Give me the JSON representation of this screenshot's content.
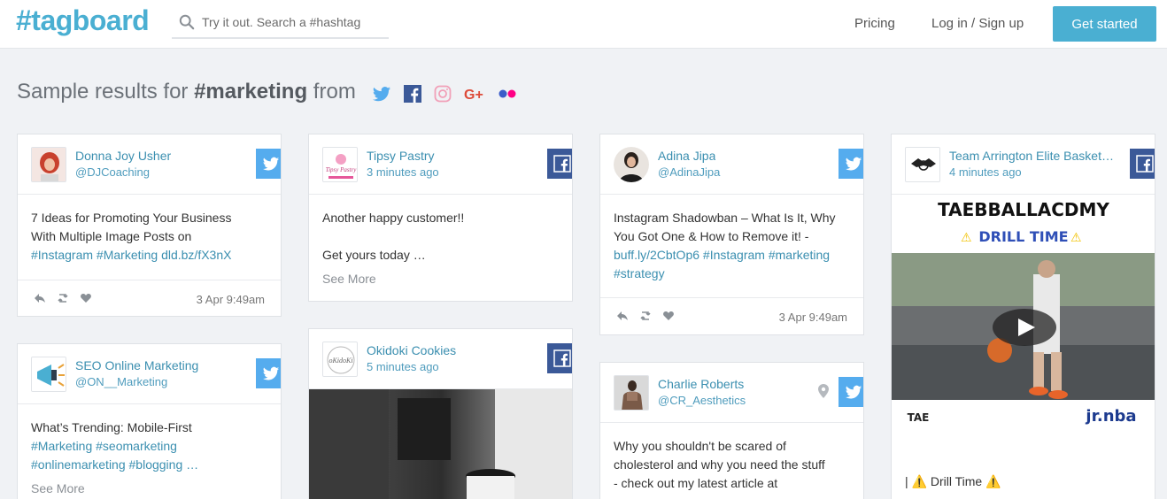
{
  "header": {
    "logo": "#tagboard",
    "search_placeholder": "Try it out. Search a #hashtag",
    "pricing": "Pricing",
    "login": "Log in / Sign up",
    "get_started": "Get started"
  },
  "results": {
    "prefix": "Sample results for ",
    "hashtag": "#marketing",
    "suffix": " from",
    "networks": [
      "twitter-icon",
      "facebook-icon",
      "instagram-icon",
      "google-plus-icon",
      "flickr-icon"
    ]
  },
  "colors": {
    "accent": "#4aafd2",
    "twitter": "#55acee",
    "facebook": "#3b5998",
    "link": "#3b8fb0"
  },
  "cards": {
    "donna": {
      "author": "Donna Joy Usher",
      "handle": "@DJCoaching",
      "network": "twitter",
      "line1": "7 Ideas for Promoting Your Business",
      "line2": "With Multiple Image Posts on",
      "line3": "#Instagram #Marketing dld.bz/fX3nX",
      "timestamp": "3 Apr 9:49am"
    },
    "seo": {
      "author": "SEO Online Marketing",
      "handle": "@ON__Marketing",
      "network": "twitter",
      "line1": "What’s Trending: Mobile-First",
      "line2": "#Marketing #seomarketing",
      "line3": "#onlinemarketing #blogging …",
      "see_more": "See More"
    },
    "tipsy": {
      "author": "Tipsy Pastry",
      "handle": "3 minutes ago",
      "network": "facebook",
      "avatar_text": "Tipsy Pastry",
      "line1": "Another happy customer!!",
      "line2": "Get yours today …",
      "see_more": "See More"
    },
    "okidoki": {
      "author": "Okidoki Cookies",
      "handle": "5 minutes ago",
      "network": "facebook",
      "avatar_text": "oKidoKi"
    },
    "adina": {
      "author": "Adina Jipa",
      "handle": "@AdinaJipa",
      "network": "twitter",
      "line1": "Instagram Shadowban – What Is It, Why",
      "line2": "You Got One & How to Remove it! -",
      "line3": "buff.ly/2CbtOp6 #Instagram #marketing",
      "line4": "#strategy",
      "timestamp": "3 Apr 9:49am"
    },
    "charlie": {
      "author": "Charlie Roberts",
      "handle": "@CR_Aesthetics",
      "network": "twitter",
      "line1": "Why you shouldn't be scared of",
      "line2": "cholesterol and why you need the stuff",
      "line3": "- check out my latest article at"
    },
    "team": {
      "author": "Team Arrington Elite Basket…",
      "handle": "4 minutes ago",
      "network": "facebook",
      "banner_title": "TAEBBALLACDMY",
      "banner_sub": "DRILL TIME",
      "logo_left": "TAE",
      "logo_right": "jr.nba",
      "caption": "| ⚠️ Drill Time ⚠️"
    }
  }
}
